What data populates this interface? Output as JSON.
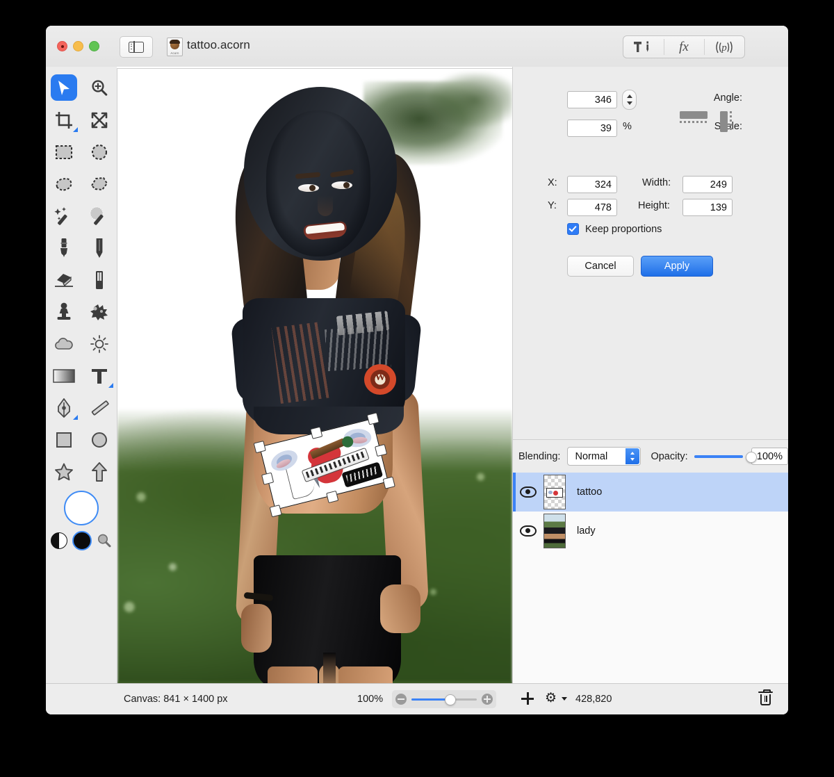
{
  "window": {
    "title": "tattoo.acorn",
    "traffic_lights": [
      "close",
      "minimize",
      "zoom"
    ],
    "sidebar_toggle": "sidebar-toggle",
    "toolbar_buttons": [
      {
        "name": "tools-icon",
        "label": ""
      },
      {
        "name": "fx-icon",
        "label": "fx"
      },
      {
        "name": "palettes-icon",
        "label": "p"
      }
    ]
  },
  "tools": {
    "items": [
      {
        "name": "move-tool",
        "selected": true
      },
      {
        "name": "zoom-tool",
        "selected": false
      },
      {
        "name": "crop-tool",
        "selected": false
      },
      {
        "name": "transform-tool",
        "selected": false
      },
      {
        "name": "rectangular-marquee-tool",
        "selected": false
      },
      {
        "name": "elliptical-marquee-tool",
        "selected": false
      },
      {
        "name": "lasso-tool",
        "selected": false
      },
      {
        "name": "polygonal-lasso-tool",
        "selected": false
      },
      {
        "name": "magic-wand-tool",
        "selected": false
      },
      {
        "name": "instant-alpha-tool",
        "selected": false
      },
      {
        "name": "brush-tool",
        "selected": false
      },
      {
        "name": "pencil-tool",
        "selected": false
      },
      {
        "name": "eraser-tool",
        "selected": false
      },
      {
        "name": "smart-eraser-tool",
        "selected": false
      },
      {
        "name": "clone-stamp-tool",
        "selected": false
      },
      {
        "name": "smudge-tool",
        "selected": false
      },
      {
        "name": "blur-tool",
        "selected": false
      },
      {
        "name": "dodge-burn-tool",
        "selected": false
      },
      {
        "name": "gradient-tool",
        "selected": false
      },
      {
        "name": "text-tool",
        "selected": false
      },
      {
        "name": "bezier-pen-tool",
        "selected": false
      },
      {
        "name": "line-tool",
        "selected": false
      },
      {
        "name": "rectangle-shape-tool",
        "selected": false
      },
      {
        "name": "ellipse-shape-tool",
        "selected": false
      },
      {
        "name": "star-shape-tool",
        "selected": false
      },
      {
        "name": "arrow-shape-tool",
        "selected": false
      }
    ],
    "swatches": {
      "foreground": "#ffffff",
      "background": "#0c0c0c",
      "accent": "#3e8bf5"
    }
  },
  "transform": {
    "angle_label": "Angle:",
    "angle_value": "346",
    "scale_label": "Scale:",
    "scale_value": "39",
    "scale_unit": "%",
    "x_label": "X:",
    "x_value": "324",
    "y_label": "Y:",
    "y_value": "478",
    "width_label": "Width:",
    "width_value": "249",
    "height_label": "Height:",
    "height_value": "139",
    "keep_proportions_label": "Keep proportions",
    "keep_proportions_checked": true,
    "flip_horizontal": "flip-horizontal-icon",
    "flip_vertical": "flip-vertical-icon",
    "cancel_label": "Cancel",
    "apply_label": "Apply",
    "apply_color": "#1f6fe8"
  },
  "layers_panel": {
    "blending_label": "Blending:",
    "blending_value": "Normal",
    "blending_options": [
      "Normal"
    ],
    "opacity_label": "Opacity:",
    "opacity_value": "100%",
    "opacity_percent": 100,
    "layers": [
      {
        "name": "tattoo",
        "visible": true,
        "selected": true,
        "thumb": "transparent-tattoo"
      },
      {
        "name": "lady",
        "visible": true,
        "selected": false,
        "thumb": "photo-lady"
      }
    ],
    "selection_color": "#bed4f8"
  },
  "status_bar": {
    "canvas_label": "Canvas: 841 × 1400 px",
    "zoom_label": "100%",
    "zoom_percent": 52,
    "add_layer_icon": "plus-icon",
    "settings_icon": "gear-icon",
    "memory_label": "428,820",
    "delete_icon": "trash-icon"
  },
  "canvas": {
    "document_name": "tattoo.acorn",
    "selection": {
      "angle_deg": -14,
      "handles": 8
    }
  }
}
